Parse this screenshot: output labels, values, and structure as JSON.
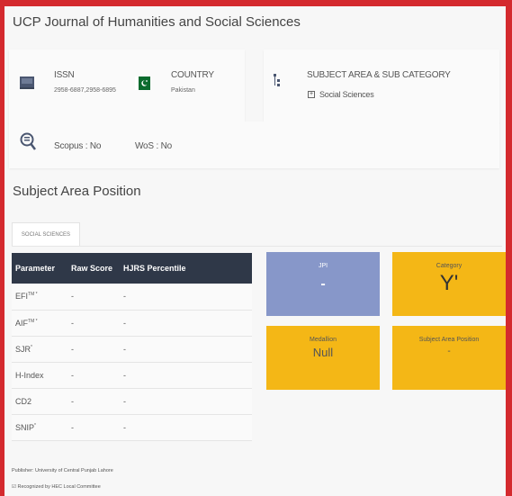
{
  "journal": {
    "title": "UCP Journal of Humanities and Social Sciences"
  },
  "info": {
    "issn_label": "ISSN",
    "issn_value": "2958-6887,2958-6895",
    "country_label": "COUNTRY",
    "country_value": "Pakistan",
    "subject_label": "SUBJECT AREA & SUB CATEGORY",
    "subject_value": "Social Sciences",
    "scopus": "Scopus : No",
    "wos": "WoS : No"
  },
  "position": {
    "title": "Subject Area Position",
    "tab": "SOCIAL SCIENCES",
    "headers": [
      "Parameter",
      "Raw Score",
      "HJRS Percentile"
    ],
    "rows": [
      {
        "param": "EFI",
        "sup": "TM *",
        "raw": "-",
        "pct": "-"
      },
      {
        "param": "AIF",
        "sup": "TM *",
        "raw": "-",
        "pct": "-"
      },
      {
        "param": "SJR",
        "sup": "*",
        "raw": "-",
        "pct": "-"
      },
      {
        "param": "H-Index",
        "sup": "",
        "raw": "-",
        "pct": "-"
      },
      {
        "param": "CD2",
        "sup": "",
        "raw": "-",
        "pct": "-"
      },
      {
        "param": "SNIP",
        "sup": "*",
        "raw": "-",
        "pct": "-"
      }
    ]
  },
  "tiles": {
    "jpi_label": "JPI",
    "jpi_value": "-",
    "category_label": "Category",
    "category_value": "Y'",
    "medallion_label": "Medallion",
    "medallion_value": "Null",
    "sap_label": "Subject Area Position",
    "sap_value": "-"
  },
  "footer": {
    "publisher": "Publisher: University of Central Punjab Lahore",
    "recognized": "Recognized by HEC Local Committee"
  },
  "colors": {
    "border": "#d42a2e",
    "tile_blue": "#8797c9",
    "tile_yellow": "#f4b716",
    "table_header": "#2f3848"
  }
}
